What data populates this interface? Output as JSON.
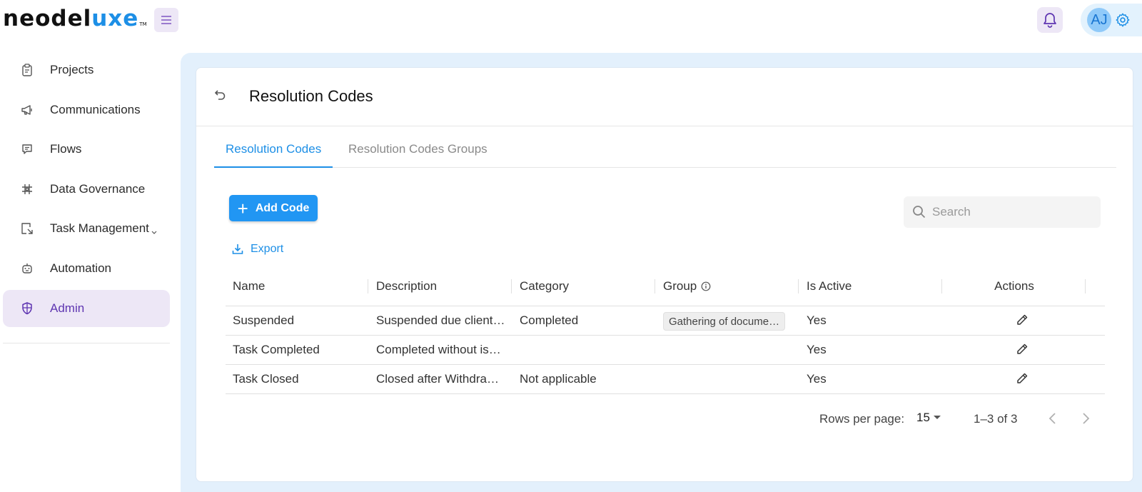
{
  "brand": {
    "logo_part1": "neodel",
    "logo_part2": "uxe",
    "logo_tm": "TM"
  },
  "user": {
    "initials": "AJ"
  },
  "sidebar": {
    "items": [
      {
        "label": "Projects",
        "icon": "clipboard-icon"
      },
      {
        "label": "Communications",
        "icon": "megaphone-icon"
      },
      {
        "label": "Flows",
        "icon": "chat-icon"
      },
      {
        "label": "Data Governance",
        "icon": "grid-icon"
      },
      {
        "label": "Task Management",
        "icon": "task-icon"
      },
      {
        "label": "Automation",
        "icon": "robot-icon"
      },
      {
        "label": "Admin",
        "icon": "shield-icon"
      }
    ],
    "active": "Admin"
  },
  "page": {
    "title": "Resolution Codes",
    "tabs": [
      {
        "label": "Resolution Codes",
        "active": true
      },
      {
        "label": "Resolution Codes Groups",
        "active": false
      }
    ],
    "add_button": "Add Code",
    "export_label": "Export",
    "search": {
      "placeholder": "Search",
      "value": ""
    }
  },
  "table": {
    "columns": [
      "Name",
      "Description",
      "Category",
      "Group",
      "Is Active",
      "Actions"
    ],
    "rows": [
      {
        "name": "Suspended",
        "description": "Suspended due client…",
        "category": "Completed",
        "group": "Gathering of docume…",
        "is_active": "Yes"
      },
      {
        "name": "Task Completed",
        "description": "Completed without is…",
        "category": "",
        "group": "",
        "is_active": "Yes"
      },
      {
        "name": "Task Closed",
        "description": "Closed after Withdra…",
        "category": "Not applicable",
        "group": "",
        "is_active": "Yes"
      }
    ]
  },
  "pagination": {
    "rows_per_page_label": "Rows per page:",
    "rows_per_page": "15",
    "range": "1–3 of 3"
  },
  "colors": {
    "accent": "#1d8fe6",
    "active_nav": "#ede7f6",
    "active_nav_text": "#5e35b1",
    "content_bg": "#e3f0fc"
  }
}
